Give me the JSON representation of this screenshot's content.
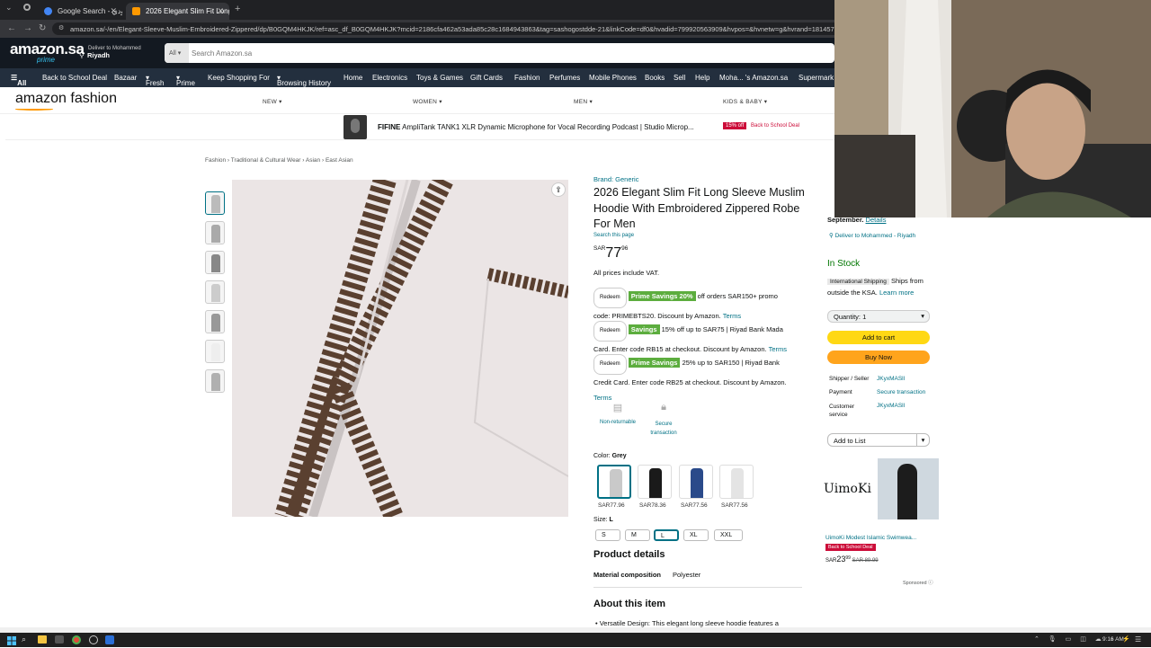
{
  "browser": {
    "tabs": [
      {
        "title": "Google Search - كبير هودي",
        "active": false
      },
      {
        "title": "2026 Elegant Slim Fit Long Sleeve",
        "active": true
      }
    ],
    "url": "amazon.sa/-/en/Elegant-Sleeve-Muslim-Embroidered-Zippered/dp/B0GQM4HKJK/ref=asc_df_B0GQM4HKJK?mcid=2186cfa462a53ada85c28c1684943863&tag=sashogostdde-21&linkCode=df0&hvadid=799920563909&hvpos=&hvnetw=g&hvrand=18145755823142280408"
  },
  "amazon": {
    "logo": "amazon.sa",
    "logo_sub": "prime",
    "deliver_line1": "Deliver to Mohammed",
    "deliver_line2": "Riyadh",
    "search_category": "All",
    "search_placeholder": "Search Amazon.sa",
    "nav_all": "All",
    "nav_items": [
      "Back to School Deal",
      "Bazaar",
      "Fresh",
      "Prime",
      "Keep Shopping For",
      "Browsing History",
      "Home",
      "Electronics",
      "Toys & Games",
      "Gift Cards",
      "Fashion",
      "Perfumes",
      "Mobile Phones",
      "Books",
      "Sell",
      "Help",
      "Moha... 's Amazon.sa",
      "Supermark"
    ]
  },
  "fashion": {
    "logo": "amazon fashion",
    "nav": [
      "NEW",
      "WOMEN",
      "MEN",
      "KIDS & BABY"
    ]
  },
  "promo": {
    "brand": "FIFINE",
    "text": "AmpliTank TANK1 XLR Dynamic Microphone for Vocal Recording Podcast | Studio Microp...",
    "badge": "15% off",
    "deal": "Back to School Deal"
  },
  "breadcrumb": [
    "Fashion",
    "Traditional & Cultural Wear",
    "Asian",
    "East Asian"
  ],
  "product": {
    "brand": "Brand: Generic",
    "title": "2026 Elegant Slim Fit Long Sleeve Muslim Hoodie With Embroidered Zippered Robe For Men",
    "search_link": "Search this page",
    "currency": "SAR",
    "price_whole": "77",
    "price_frac": "96",
    "vat": "All prices include VAT.",
    "offers": [
      {
        "btn": "Redeem",
        "tag": "Prime Savings 20%",
        "text1": "off orders SAR150+ promo",
        "text2": "code: PRIMEBTS20. Discount by Amazon.",
        "terms": "Terms"
      },
      {
        "btn": "Redeem",
        "tag": "Savings",
        "text1": "15% off up to SAR75 | Riyad Bank Mada",
        "text2": "Card. Enter code RB15 at checkout. Discount by Amazon.",
        "terms": "Terms"
      },
      {
        "btn": "Redeem",
        "tag": "Prime Savings",
        "text1": "25% up to SAR150 | Riyad Bank",
        "text2": "Credit Card. Enter code RB25 at checkout. Discount by Amazon.",
        "terms": "Terms"
      }
    ],
    "features": [
      "Non-returnable",
      "Secure transaction"
    ],
    "color_label": "Color:",
    "color_value": "Grey",
    "swatches": [
      {
        "price": "SAR77.96",
        "color": "#c9c9c9"
      },
      {
        "price": "SAR78.36",
        "color": "#1a1a1a"
      },
      {
        "price": "SAR77.56",
        "color": "#2a4a8a"
      },
      {
        "price": "SAR77.56",
        "color": "#e4e4e4"
      }
    ],
    "size_label": "Size:",
    "size_value": "L",
    "sizes": [
      "S",
      "M",
      "L",
      "XL",
      "XXL"
    ],
    "details_heading": "Product details",
    "material_label": "Material composition",
    "material_value": "Polyester",
    "about_heading": "About this item",
    "about_bullet": "Versatile Design: This elegant long sleeve hoodie features a"
  },
  "buybox": {
    "delivery_line": "September.",
    "details_link": "Details",
    "deliver_to": "Deliver to Mohammed - Riyadh",
    "stock": "In Stock",
    "intl_tag": "International Shipping",
    "ships_text": "Ships from outside the KSA.",
    "learn_more": "Learn more",
    "quantity": "Quantity: 1",
    "add_to_cart": "Add to cart",
    "buy_now": "Buy Now",
    "shipper_label": "Shipper / Seller",
    "shipper_value": "JKyxMASll",
    "payment_label": "Payment",
    "payment_value": "Secure transaction",
    "customer_label": "Customer service",
    "customer_value": "JKyxMASll",
    "add_to_list": "Add to List"
  },
  "ad": {
    "brand": "UimoKi",
    "title": "UimoKi Modest Islamic Swimwea...",
    "deal": "Back to School Deal",
    "price_whole": "23",
    "price_frac": "99",
    "currency": "SAR",
    "list_price": "SAR 89.99",
    "sponsored": "Sponsored"
  },
  "taskbar": {
    "time": "9:16 AM"
  },
  "colors": {
    "amazon_dark": "#131921",
    "amazon_nav": "#232f3e",
    "link": "#007185",
    "in_stock": "#007600",
    "add_to_cart": "#ffd814",
    "buy_now": "#ffa41c",
    "deal_red": "#cc0c39"
  }
}
